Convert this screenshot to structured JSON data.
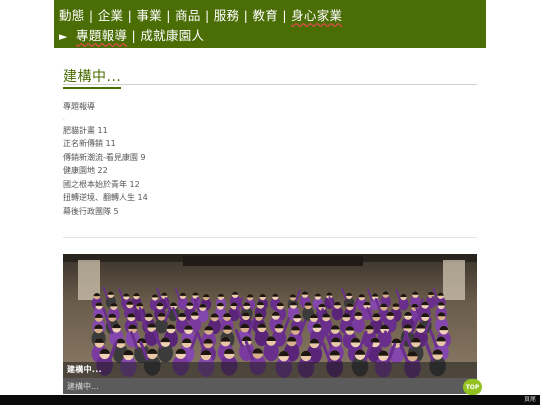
{
  "nav": {
    "row1": [
      "動態",
      "企業",
      "事業",
      "商品",
      "服務",
      "教育",
      "身心家業"
    ],
    "separator": "|",
    "row2_arrow": "►",
    "row2": [
      "專題報導",
      "成就康園人"
    ]
  },
  "page": {
    "title": "建構中...",
    "breadcrumb": "專題報導",
    "dot": ".",
    "items": [
      "肥貓計畫 11",
      "正名新傳銷 11",
      "傳銷新潮流-看見康園 9",
      "健康園地 22",
      "國之根本始於青年 12",
      "扭轉逆境、翻轉人生 14",
      "幕後行政團隊 5"
    ]
  },
  "photo": {
    "caption_title": "建構中...",
    "caption_sub": "建構中..."
  },
  "top_button": "TOP",
  "footer": {
    "label": "頁尾"
  },
  "colors": {
    "nav_bg": "#4b6d05",
    "accent_green": "#92c120",
    "crowd": "#6a2f8c"
  }
}
